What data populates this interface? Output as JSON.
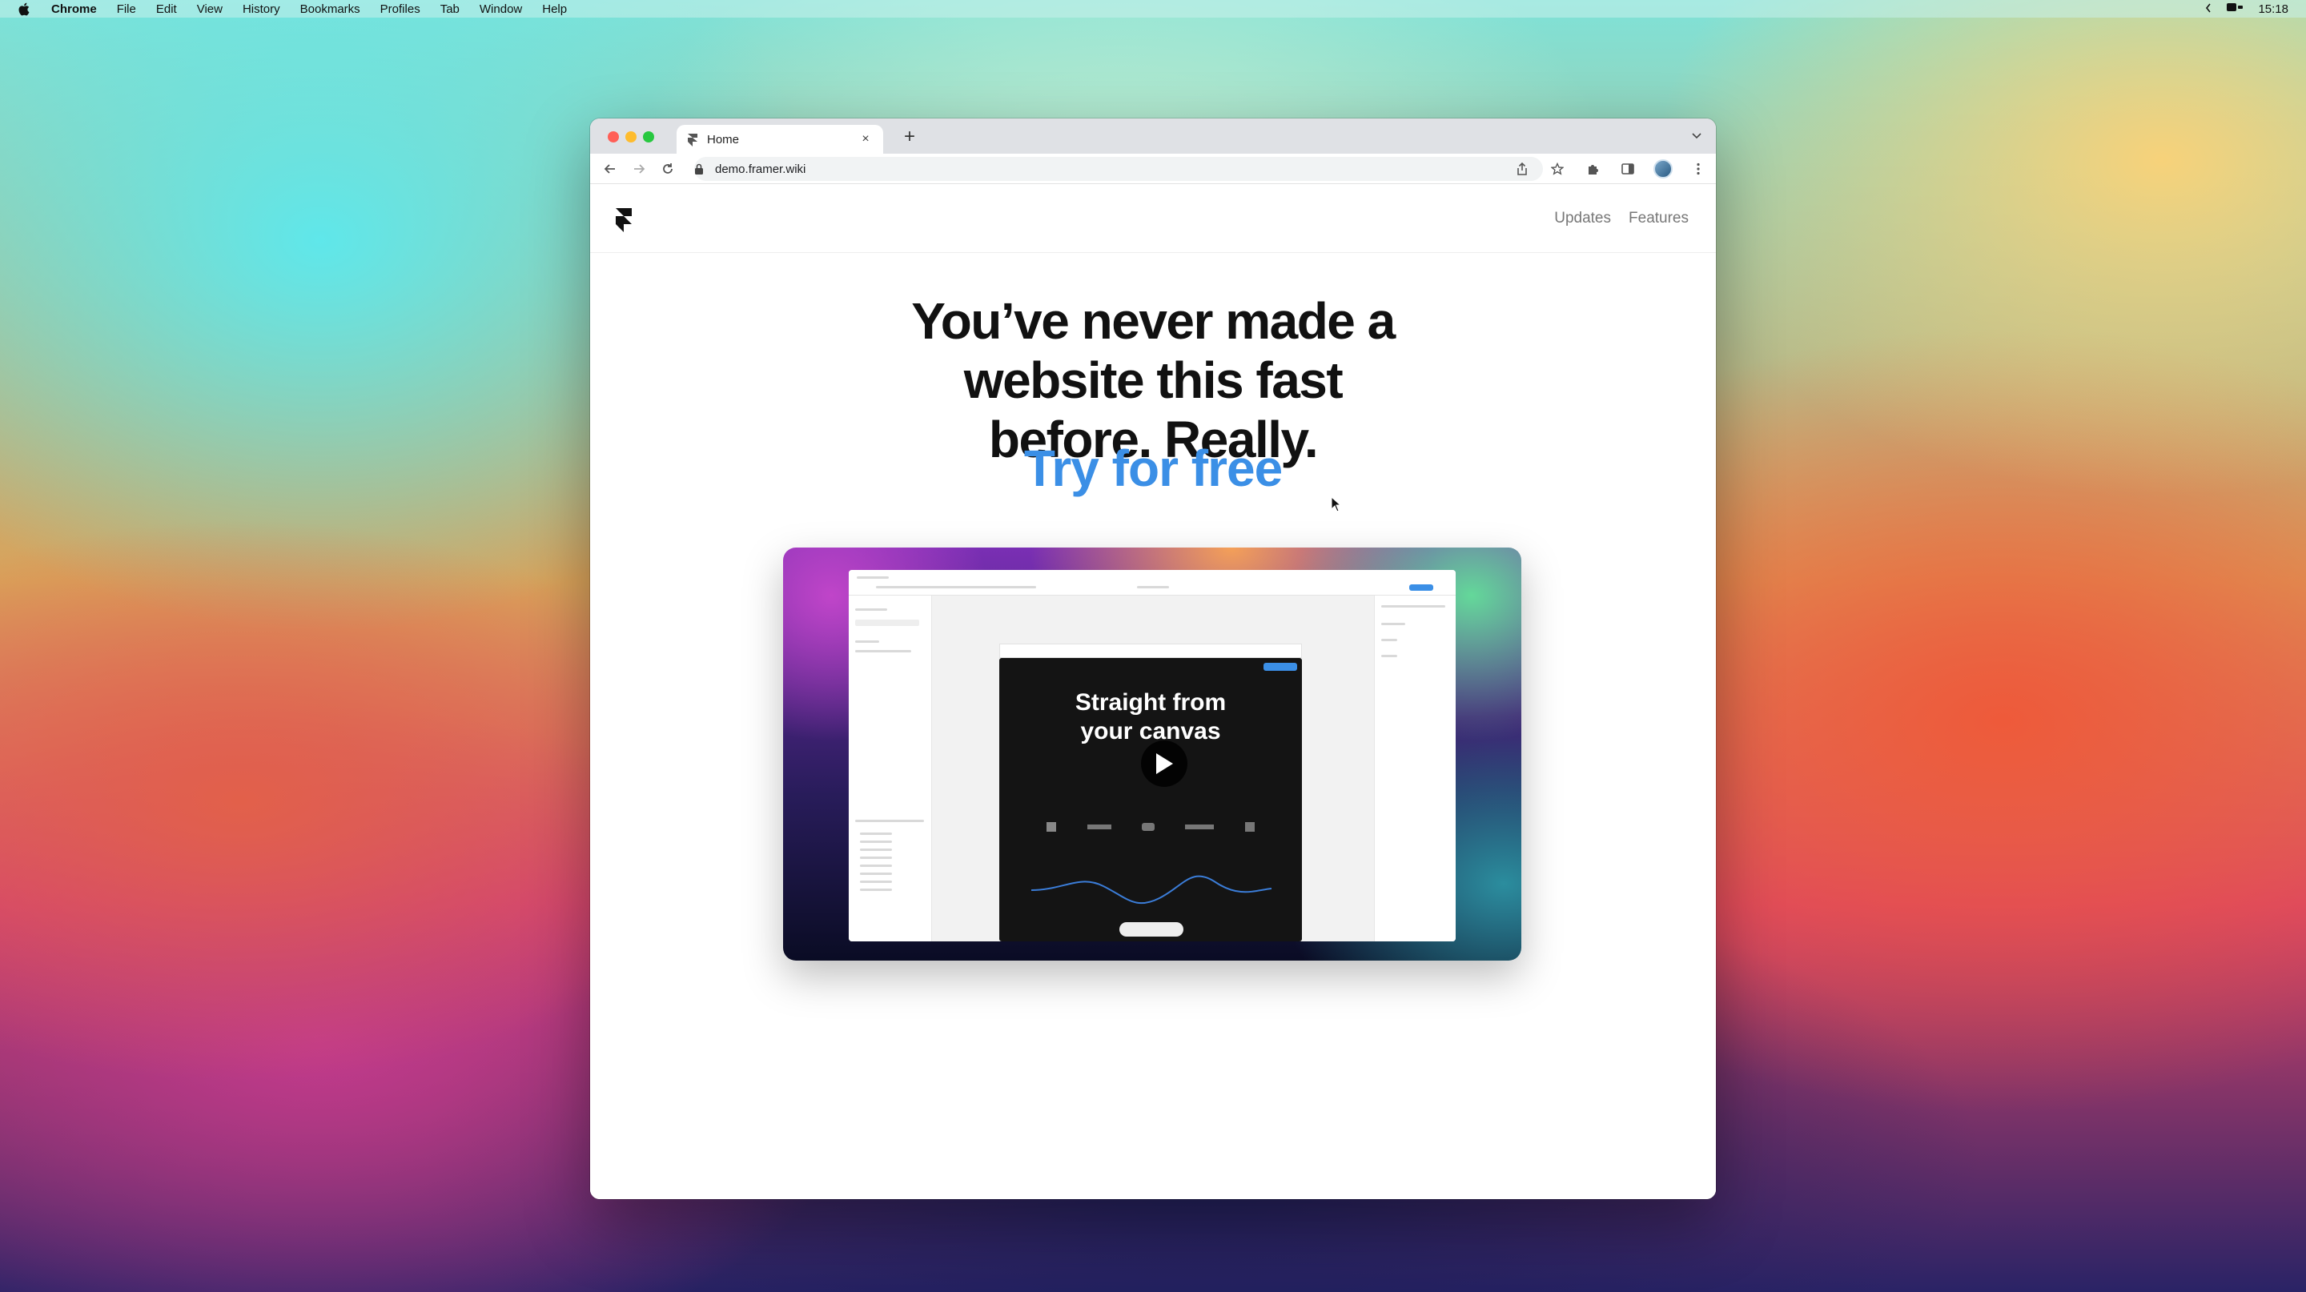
{
  "menubar": {
    "app_name": "Chrome",
    "items": [
      "File",
      "Edit",
      "View",
      "History",
      "Bookmarks",
      "Profiles",
      "Tab",
      "Window",
      "Help"
    ],
    "time": "15:18"
  },
  "browser": {
    "tab_title": "Home",
    "url": "demo.framer.wiki"
  },
  "site": {
    "nav": [
      "Updates",
      "Features"
    ],
    "hero_lines": [
      "You’ve never made a",
      "website this fast",
      "before. Really."
    ],
    "cta": "Try for free"
  },
  "video": {
    "heading_lines": [
      "Straight from",
      "your canvas"
    ]
  },
  "colors": {
    "cta": "#3b8fe6",
    "tab_strip": "#dfe1e5"
  }
}
